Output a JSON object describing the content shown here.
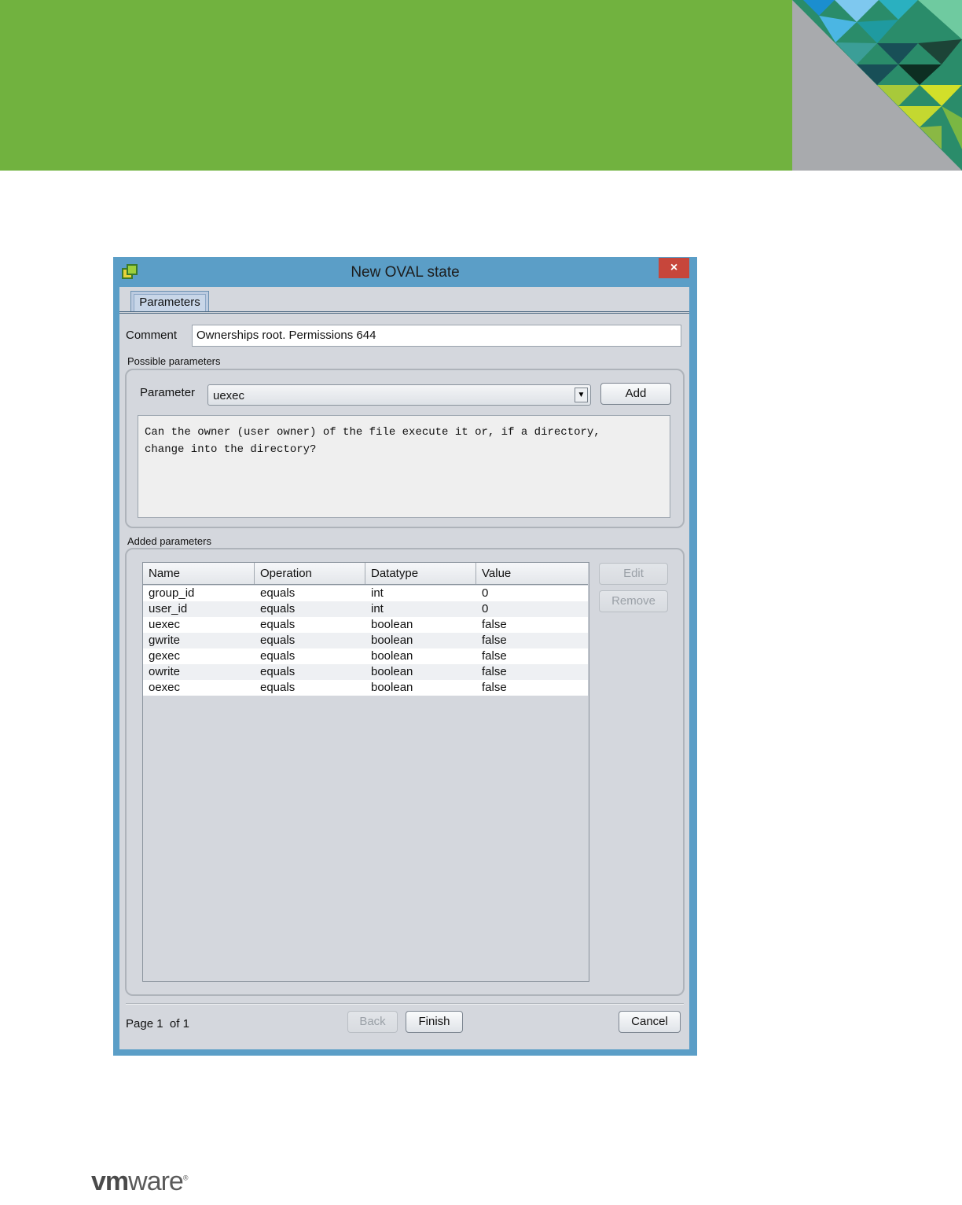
{
  "window": {
    "title": "New OVAL state",
    "close_label": "×"
  },
  "tabs": [
    {
      "label": "Parameters"
    }
  ],
  "comment": {
    "label": "Comment",
    "value": "Ownerships root. Permissions 644"
  },
  "possible_parameters": {
    "title": "Possible parameters",
    "parameter_label": "Parameter",
    "selected": "uexec",
    "add_label": "Add",
    "description_line1": "Can the owner (user owner) of the file execute it or, if a directory,",
    "description_line2": "change into the directory?"
  },
  "added_parameters": {
    "title": "Added parameters",
    "columns": [
      "Name",
      "Operation",
      "Datatype",
      "Value"
    ],
    "rows": [
      [
        "group_id",
        "equals",
        "int",
        "0"
      ],
      [
        "user_id",
        "equals",
        "int",
        "0"
      ],
      [
        "uexec",
        "equals",
        "boolean",
        "false"
      ],
      [
        "gwrite",
        "equals",
        "boolean",
        "false"
      ],
      [
        "gexec",
        "equals",
        "boolean",
        "false"
      ],
      [
        "owrite",
        "equals",
        "boolean",
        "false"
      ],
      [
        "oexec",
        "equals",
        "boolean",
        "false"
      ]
    ],
    "edit_label": "Edit",
    "remove_label": "Remove"
  },
  "footer": {
    "page_label": "Page",
    "page_current": "1",
    "of_label": "of",
    "page_total": "1",
    "back_label": "Back",
    "finish_label": "Finish",
    "cancel_label": "Cancel"
  },
  "brand": {
    "logo_vm": "vm",
    "logo_ware": "ware",
    "logo_reg": "®"
  },
  "colors": {
    "banner_green": "#71b23f",
    "window_blue": "#5b9ec7",
    "close_red": "#c7463b"
  }
}
